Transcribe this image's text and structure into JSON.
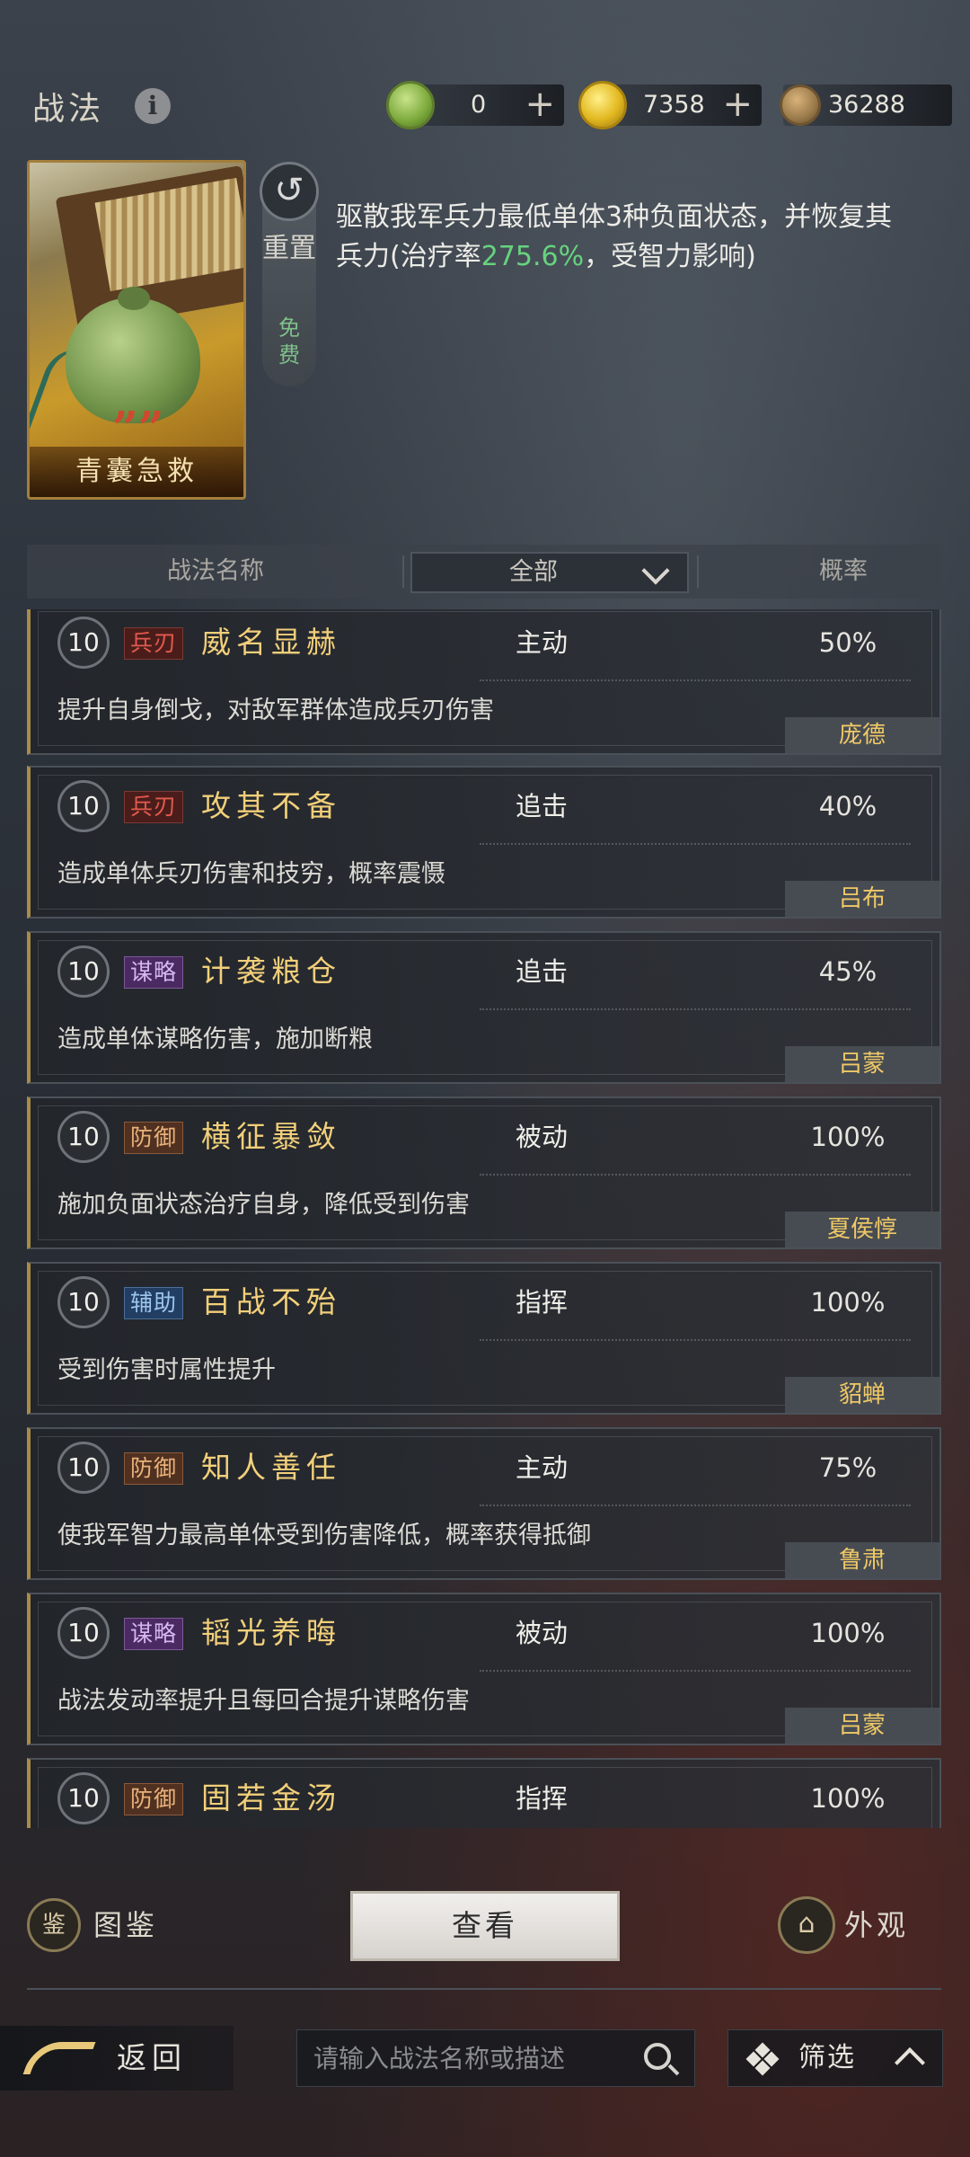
{
  "header": {
    "title": "战法",
    "info_icon": "info-icon",
    "currencies": [
      {
        "icon": "jade-coin-icon",
        "value": "0",
        "color": "#8fbf4a",
        "has_plus": true
      },
      {
        "icon": "gold-coin-icon",
        "value": "7358",
        "color": "#e2b820",
        "has_plus": true
      },
      {
        "icon": "copper-coin-icon",
        "value": "36288",
        "color": "#9a7a4a",
        "has_plus": false
      }
    ],
    "plus_label": "+"
  },
  "preview": {
    "card_name": "青囊急救",
    "card_quote_mark": "”",
    "reset_label": "重置",
    "free_label": "免费",
    "description_before": "驱散我军兵力最低单体3种负面状态，并恢复其兵力(治疗率",
    "description_highlight": "275.6%",
    "description_after": "，受智力影响)"
  },
  "table_header": {
    "name_col": "战法名称",
    "filter_value": "全部",
    "prob_col": "概率"
  },
  "skills": [
    {
      "level": "10",
      "tag": "兵刃",
      "tag_kind": "blade",
      "name": "威名显赫",
      "type": "主动",
      "prob": "50%",
      "desc": "提升自身倒戈，对敌军群体造成兵刃伤害",
      "owner": "庞德"
    },
    {
      "level": "10",
      "tag": "兵刃",
      "tag_kind": "blade",
      "name": "攻其不备",
      "type": "追击",
      "prob": "40%",
      "desc": "造成单体兵刃伤害和技穷，概率震慑",
      "owner": "吕布"
    },
    {
      "level": "10",
      "tag": "谋略",
      "tag_kind": "plot",
      "name": "计袭粮仓",
      "type": "追击",
      "prob": "45%",
      "desc": "造成单体谋略伤害，施加断粮",
      "owner": "吕蒙"
    },
    {
      "level": "10",
      "tag": "防御",
      "tag_kind": "def",
      "name": "横征暴敛",
      "type": "被动",
      "prob": "100%",
      "desc": "施加负面状态治疗自身，降低受到伤害",
      "owner": "夏侯惇"
    },
    {
      "level": "10",
      "tag": "辅助",
      "tag_kind": "aid",
      "name": "百战不殆",
      "type": "指挥",
      "prob": "100%",
      "desc": "受到伤害时属性提升",
      "owner": "貂蝉"
    },
    {
      "level": "10",
      "tag": "防御",
      "tag_kind": "def",
      "name": "知人善任",
      "type": "主动",
      "prob": "75%",
      "desc": "使我军智力最高单体受到伤害降低，概率获得抵御",
      "owner": "鲁肃"
    },
    {
      "level": "10",
      "tag": "谋略",
      "tag_kind": "plot",
      "name": "韬光养晦",
      "type": "被动",
      "prob": "100%",
      "desc": "战法发动率提升且每回合提升谋略伤害",
      "owner": "吕蒙"
    },
    {
      "level": "10",
      "tag": "防御",
      "tag_kind": "def",
      "name": "固若金汤",
      "type": "指挥",
      "prob": "100%",
      "desc": "",
      "owner": ""
    }
  ],
  "footer": {
    "atlas_label": "图鉴",
    "atlas_icon_glyph": "鉴",
    "view_label": "查看",
    "appearance_label": "外观",
    "back_label": "返回",
    "search_placeholder": "请输入战法名称或描述",
    "filter_label": "筛选"
  },
  "colors": {
    "gold_name": "#f2cf7a",
    "heal_green": "#66d37e",
    "owner_text": "#f0c966"
  }
}
